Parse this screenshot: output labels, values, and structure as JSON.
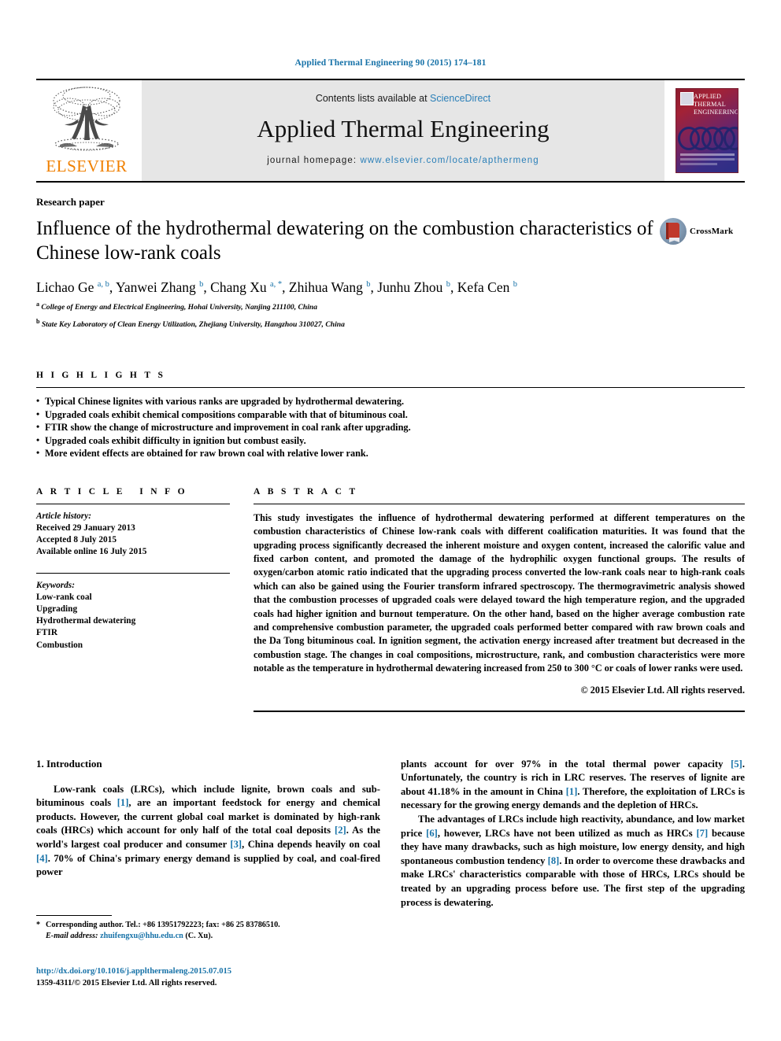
{
  "running_head": "Applied Thermal Engineering 90 (2015) 174–181",
  "masthead": {
    "publisher_word": "ELSEVIER",
    "contents_prefix": "Contents lists available at ",
    "contents_link": "ScienceDirect",
    "journal_title": "Applied Thermal Engineering",
    "homepage_prefix": "journal homepage: ",
    "homepage_url": "www.elsevier.com/locate/apthermeng",
    "cover_title_line1": "APPLIED",
    "cover_title_line2": "THERMAL",
    "cover_title_line3": "ENGINEERING"
  },
  "article": {
    "type": "Research paper",
    "title": "Influence of the hydrothermal dewatering on the combustion characteristics of Chinese low-rank coals",
    "crossmark_label": "CrossMark",
    "authors_html": "Lichao Ge <sup>a, b</sup>, Yanwei Zhang <sup>b</sup>, Chang Xu <sup>a, *</sup>, Zhihua Wang <sup>b</sup>, Junhu Zhou <sup>b</sup>, Kefa Cen <sup>b</sup>",
    "affiliation_a": "College of Energy and Electrical Engineering, Hohai University, Nanjing 211100, China",
    "affiliation_b": "State Key Laboratory of Clean Energy Utilization, Zhejiang University, Hangzhou 310027, China"
  },
  "highlights": {
    "heading": "HIGHLIGHTS",
    "items": [
      "Typical Chinese lignites with various ranks are upgraded by hydrothermal dewatering.",
      "Upgraded coals exhibit chemical compositions comparable with that of bituminous coal.",
      "FTIR show the change of microstructure and improvement in coal rank after upgrading.",
      "Upgraded coals exhibit difficulty in ignition but combust easily.",
      "More evident effects are obtained for raw brown coal with relative lower rank."
    ]
  },
  "article_info": {
    "heading": "ARTICLE INFO",
    "history_label": "Article history:",
    "received": "Received 29 January 2013",
    "accepted": "Accepted 8 July 2015",
    "available": "Available online 16 July 2015",
    "keywords_label": "Keywords:",
    "keywords": [
      "Low-rank coal",
      "Upgrading",
      "Hydrothermal dewatering",
      "FTIR",
      "Combustion"
    ]
  },
  "abstract": {
    "heading": "ABSTRACT",
    "text": "This study investigates the influence of hydrothermal dewatering performed at different temperatures on the combustion characteristics of Chinese low-rank coals with different coalification maturities. It was found that the upgrading process significantly decreased the inherent moisture and oxygen content, increased the calorific value and fixed carbon content, and promoted the damage of the hydrophilic oxygen functional groups. The results of oxygen/carbon atomic ratio indicated that the upgrading process converted the low-rank coals near to high-rank coals which can also be gained using the Fourier transform infrared spectroscopy. The thermogravimetric analysis showed that the combustion processes of upgraded coals were delayed toward the high temperature region, and the upgraded coals had higher ignition and burnout temperature. On the other hand, based on the higher average combustion rate and comprehensive combustion parameter, the upgraded coals performed better compared with raw brown coals and the Da Tong bituminous coal. In ignition segment, the activation energy increased after treatment but decreased in the combustion stage. The changes in coal compositions, microstructure, rank, and combustion characteristics were more notable as the temperature in hydrothermal dewatering increased from 250 to 300 °C or coals of lower ranks were used.",
    "copyright": "© 2015 Elsevier Ltd. All rights reserved."
  },
  "introduction": {
    "section_title": "1. Introduction",
    "left_paragraph_html": "Low-rank coals (LRCs), which include lignite, brown coals and sub-bituminous coals <span class=\"cite\">[1]</span>, are an important feedstock for energy and chemical products. However, the current global coal market is dominated by high-rank coals (HRCs) which account for only half of the total coal deposits <span class=\"cite\">[2]</span>. As the world's largest coal producer and consumer <span class=\"cite\">[3]</span>, China depends heavily on coal <span class=\"cite\">[4]</span>. 70% of China's primary energy demand is supplied by coal, and coal-fired power",
    "right_paragraph_1_html": "plants account for over 97% in the total thermal power capacity <span class=\"cite\">[5]</span>. Unfortunately, the country is rich in LRC reserves. The reserves of lignite are about 41.18% in the amount in China <span class=\"cite\">[1]</span>. Therefore, the exploitation of LRCs is necessary for the growing energy demands and the depletion of HRCs.",
    "right_paragraph_2_html": "The advantages of LRCs include high reactivity, abundance, and low market price <span class=\"cite\">[6]</span>, however, LRCs have not been utilized as much as HRCs <span class=\"cite\">[7]</span> because they have many drawbacks, such as high moisture, low energy density, and high spontaneous combustion tendency <span class=\"cite\">[8]</span>. In order to overcome these drawbacks and make LRCs' characteristics comparable with those of HRCs, LRCs should be treated by an upgrading process before use. The first step of the upgrading process is dewatering."
  },
  "footnote": {
    "corresponding_html": "<span class=\"star\">*</span> Corresponding author. Tel.: +86 13951792223; fax: +86 25 83786510.",
    "email_html": "<span class=\"ital\">E-mail address:</span> <span class=\"link\">zhuifengxu@hhu.edu.cn</span> (C. Xu)."
  },
  "footer": {
    "doi": "http://dx.doi.org/10.1016/j.applthermaleng.2015.07.015",
    "issn_line": "1359-4311/© 2015 Elsevier Ltd. All rights reserved."
  }
}
